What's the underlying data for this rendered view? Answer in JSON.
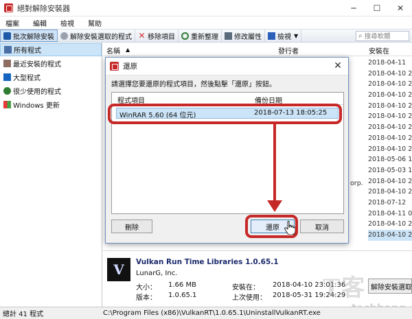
{
  "window": {
    "title": "絕對解除安裝器"
  },
  "menu": [
    "檔案",
    "編輯",
    "檢視",
    "幫助"
  ],
  "toolbar": {
    "batch_uninstall": "批次解除安裝",
    "uninstall_selected": "解除安裝選取的程式",
    "remove_item": "移除項目",
    "refresh": "重新整理",
    "modify_props": "修改屬性",
    "view": "檢視",
    "search_placeholder": "搜尋軟體"
  },
  "sidebar": {
    "items": [
      {
        "label": "所有程式",
        "selected": true
      },
      {
        "label": "最近安裝的程式"
      },
      {
        "label": "大型程式"
      },
      {
        "label": "很少使用的程式"
      },
      {
        "label": "Windows 更新"
      }
    ]
  },
  "list": {
    "col_name": "名稱",
    "col_publisher": "發行者",
    "col_installed": "安裝在",
    "partial_publisher": "orp.",
    "dates": [
      "2018-04-11",
      "2018-04-10 2",
      "2018-04-10 22",
      "2018-04-10 22",
      "2018-04-10 22",
      "2018-04-10 22",
      "2018-04-10 22",
      "2018-04-10 22",
      "2018-04-10 22",
      "2018-05-06 16",
      "2018-05-03 13",
      "2018-04-10 2",
      "2018-04-10 2",
      "2018-07-12",
      "2018-04-11 02",
      "2018-04-10 22",
      "2018-04-10 23"
    ]
  },
  "details": {
    "name": "Vulkan Run Time Libraries 1.0.65.1",
    "publisher": "LunarG, Inc.",
    "size_label": "大小：",
    "size_value": "1.66 MB",
    "version_label": "版本：",
    "version_value": "1.0.65.1",
    "installed_label": "安裝在：",
    "installed_value": "2018-04-10 23:01:36",
    "lastused_label": "上次使用：",
    "lastused_value": "2018-05-31 19:24:29",
    "uninstall_button": "解除安裝選取"
  },
  "status": {
    "count": "總計 41 程式",
    "path": "C:\\Program Files (x86)\\VulkanRT\\1.0.65.1\\UninstallVulkanRT.exe"
  },
  "dialog": {
    "title": "還原",
    "instruction": "請選擇您要還原的程式項目，然後點擊「還原」按鈕。",
    "col_item": "程式項目",
    "col_backup_date": "備份日期",
    "row_name": "WinRAR 5.60 (64 位元)",
    "row_date": "2018-07-13 18:05:25",
    "delete_button": "刪除",
    "restore_button": "還原",
    "cancel_button": "取消"
  },
  "watermark": {
    "brand": "techbang.com"
  },
  "colors": {
    "highlight": "#c62828",
    "selection": "#cce4f7",
    "accent": "#1f5aa6"
  }
}
